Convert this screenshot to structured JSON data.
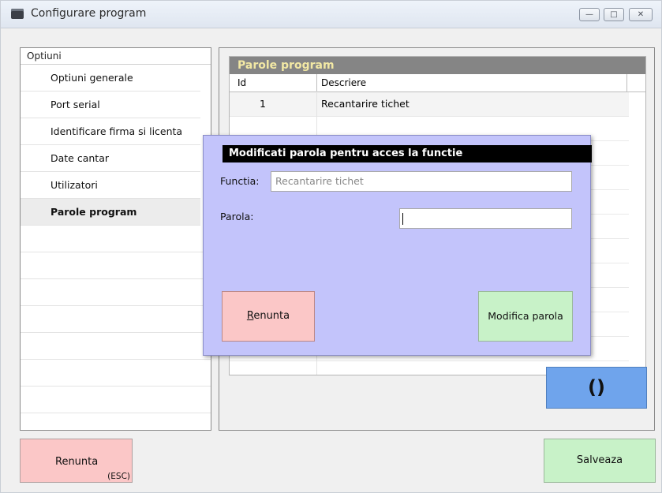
{
  "window": {
    "title": "Configurare program",
    "controls": [
      "minimize",
      "maximize",
      "close"
    ]
  },
  "sidebar": {
    "header": "Optiuni",
    "items": [
      {
        "label": "Optiuni generale",
        "active": false
      },
      {
        "label": "Port serial",
        "active": false
      },
      {
        "label": "Identificare firma si licenta",
        "active": false
      },
      {
        "label": "Date cantar",
        "active": false
      },
      {
        "label": "Utilizatori",
        "active": false
      },
      {
        "label": "Parole program",
        "active": true
      }
    ]
  },
  "grid": {
    "title": "Parole program",
    "columns": [
      "Id",
      "Descriere"
    ],
    "rows": [
      {
        "id": "1",
        "descriere": "Recantarire tichet"
      }
    ]
  },
  "side_button": {
    "label": "()"
  },
  "footer": {
    "cancel_label": "Renunta",
    "cancel_hint": "(ESC)",
    "save_label": "Salveaza"
  },
  "dialog": {
    "title": "Modificati parola pentru acces la functie",
    "functia_label": "Functia:",
    "functia_value": "Recantarire tichet",
    "parola_label": "Parola:",
    "parola_value": "",
    "cancel_label_rest": "enunta",
    "cancel_label_first": "R",
    "ok_label": "Modifica parola"
  },
  "colors": {
    "dialog_bg": "#c3c4fb",
    "cancel_bg": "#fbc7c7",
    "ok_bg": "#c8f2c8",
    "grid_title_bg": "#858585",
    "grid_title_fg": "#f2e8a4",
    "side_button_bg": "#6fa4ec"
  }
}
